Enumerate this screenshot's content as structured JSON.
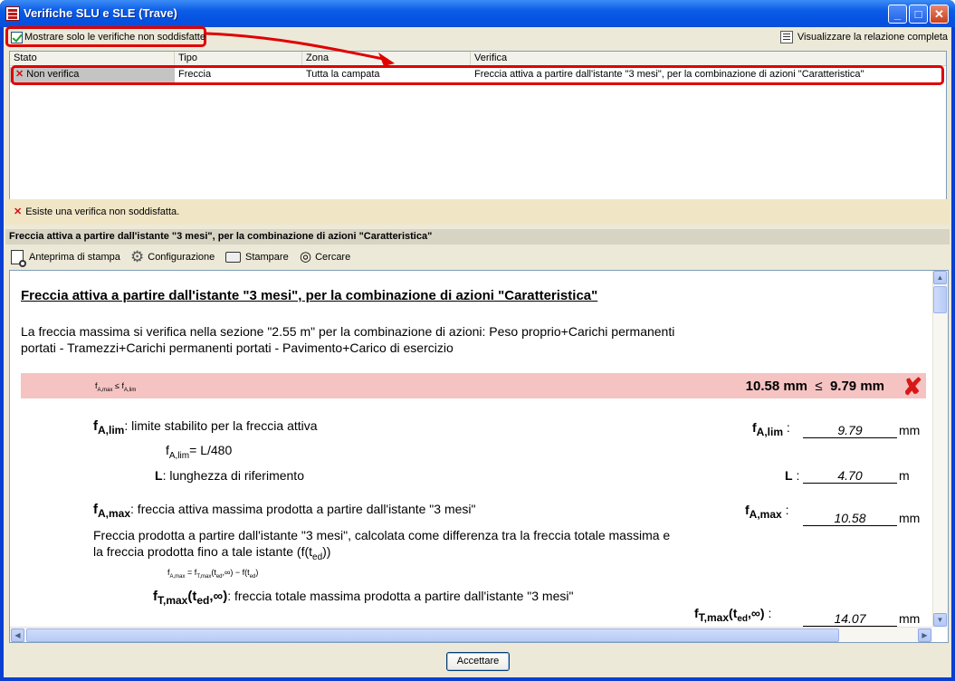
{
  "window": {
    "title": "Verifiche SLU e SLE (Trave)"
  },
  "filter": {
    "checkbox_label": "Mostrare solo le verifiche non soddisfatte",
    "checked": true
  },
  "report_link": "Visualizzare la relazione completa",
  "list": {
    "columns": [
      "Stato",
      "Tipo",
      "Zona",
      "Verifica"
    ],
    "rows": [
      {
        "status": "Non verifica",
        "type": "Freccia",
        "zone": "Tutta la campata",
        "check": "Freccia attiva a partire dall'istante \"3 mesi\", per la combinazione di azioni \"Caratteristica\""
      }
    ]
  },
  "message": "Esiste una verifica non soddisfatta.",
  "section_title": "Freccia attiva a partire dall'istante \"3 mesi\", per la combinazione di azioni \"Caratteristica\"",
  "toolbar": {
    "preview": "Anteprima di stampa",
    "config": "Configurazione",
    "print": "Stampare",
    "search": "Cercare"
  },
  "doc": {
    "title": "Freccia attiva a partire dall'istante \"3 mesi\", per la combinazione di azioni \"Caratteristica\"",
    "intro": "La freccia massima si verifica nella sezione \"2.55 m\" per la combinazione di azioni: Peso proprio+Carichi permanenti portati - Tramezzi+Carichi permanenti portati - Pavimento+Carico di esercizio",
    "condition": {
      "lhs": "f",
      "lhs_sub": "A,max",
      "op": "≤",
      "rhs": "f",
      "rhs_sub": "A,lim",
      "value_left": "10.58 mm",
      "op2": "≤",
      "value_right": "9.79 mm"
    },
    "flim": {
      "symbol": "f",
      "sub": "A,lim",
      "desc": ": limite stabilito per la freccia attiva",
      "formula_sym": "f",
      "formula_sub": "A,lim",
      "formula_rhs": "= L/480",
      "value": "9.79",
      "unit": "mm"
    },
    "L": {
      "symbol": "L",
      "desc": ": lunghezza di riferimento",
      "value": "4.70",
      "unit": "m"
    },
    "fmax": {
      "symbol": "f",
      "sub": "A,max",
      "desc": ": freccia attiva massima prodotta a partire dall'istante \"3 mesi\"",
      "value": "10.58",
      "unit": "mm",
      "text": "Freccia prodotta a partire dall'istante \"3 mesi\", calcolata come differenza tra la freccia totale massima e la freccia prodotta fino a tale istante (f(t",
      "text_sub": "ed",
      "text_end": "))"
    },
    "formula_small": {
      "lhs": "f",
      "lhs_sub": "A,max",
      "rhs": "= f",
      "rhs_sub": "T,max",
      "rest": "(t",
      "rest_sub": "ed",
      "tail": ",∞) − f(t",
      "tail_sub": "ed",
      "end": ")"
    },
    "ftmax": {
      "symbol": "f",
      "sub": "T,max",
      "arg": "(t",
      "arg_sub": "ed",
      "arg_end": ",∞)",
      "desc": ": freccia totale massima prodotta a partire dall'istante \"3 mesi\"",
      "value": "14.07",
      "unit": "mm"
    }
  },
  "ok_button": "Accettare",
  "colors": {
    "highlight": "#e00000",
    "fail_bar": "#f5c4c2",
    "message_bar": "#f0e6c6"
  }
}
